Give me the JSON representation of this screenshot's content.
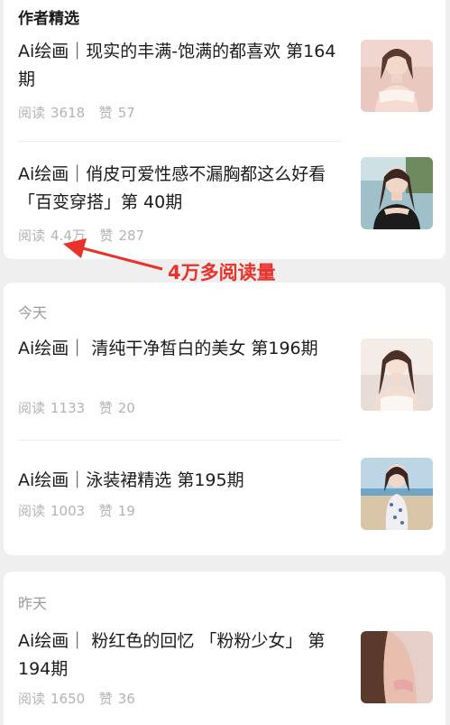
{
  "featured": {
    "heading": "作者精选",
    "articles": [
      {
        "title": "Ai绘画｜现实的丰满-饱满的都喜欢 第164期",
        "read_label": "阅读",
        "reads": "3618",
        "like_label": "赞",
        "likes": "57"
      },
      {
        "title": "Ai绘画｜俏皮可爱性感不漏胸都这么好看 「百变穿搭」第 40期",
        "read_label": "阅读",
        "reads": "4.4万",
        "like_label": "赞",
        "likes": "287"
      }
    ]
  },
  "annotation": {
    "text": "4万多阅读量",
    "color": "#e8322a"
  },
  "today": {
    "heading": "今天",
    "articles": [
      {
        "title": "Ai绘画｜ 清纯干净皙白的美女 第196期",
        "read_label": "阅读",
        "reads": "1133",
        "like_label": "赞",
        "likes": "20"
      },
      {
        "title": "Ai绘画｜泳装裙精选 第195期",
        "read_label": "阅读",
        "reads": "1003",
        "like_label": "赞",
        "likes": "19"
      }
    ]
  },
  "yesterday": {
    "heading": "昨天",
    "articles": [
      {
        "title": "Ai绘画｜ 粉红色的回忆 「粉粉少女」 第194期",
        "read_label": "阅读",
        "reads": "1650",
        "like_label": "赞",
        "likes": "36"
      }
    ]
  }
}
